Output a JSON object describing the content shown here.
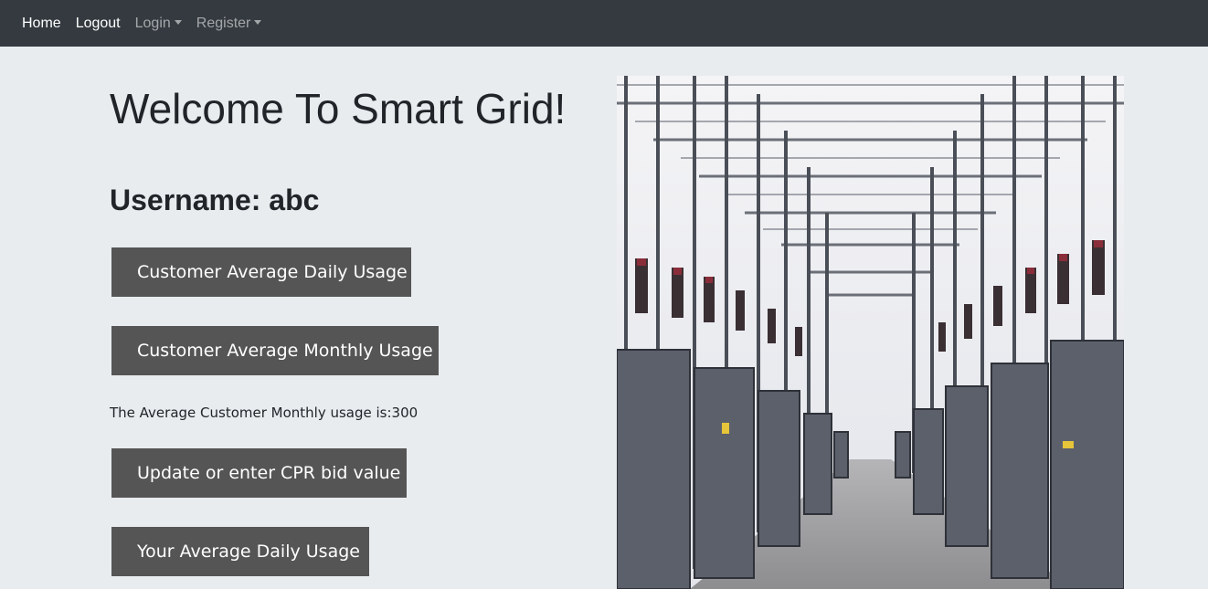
{
  "nav": {
    "home": "Home",
    "logout": "Logout",
    "login": "Login",
    "register": "Register"
  },
  "main": {
    "title": "Welcome To Smart Grid!",
    "username_label": "Username: abc",
    "buttons": {
      "daily_usage": "Customer Average Daily Usage",
      "monthly_usage": "Customer Average Monthly Usage",
      "cpr_bid": "Update or enter CPR bid value",
      "your_daily_usage": "Your Average Daily Usage"
    },
    "monthly_message": "The Average Customer Monthly usage is:300"
  },
  "colors": {
    "navbar_bg": "#343a40",
    "page_bg": "#e9ecef",
    "button_bg": "#555555"
  }
}
